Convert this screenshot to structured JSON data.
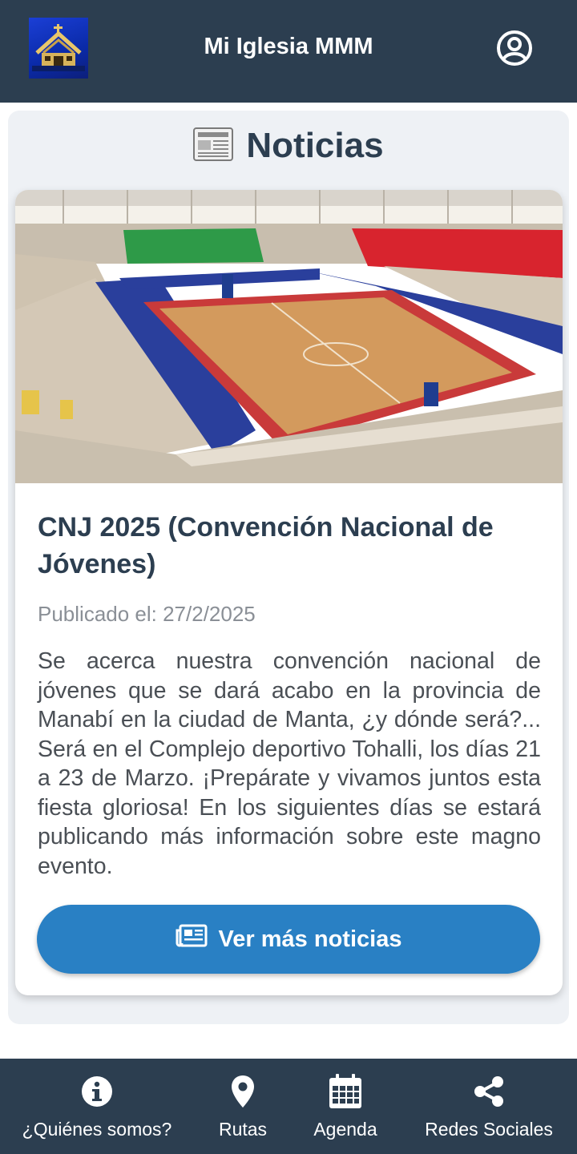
{
  "header": {
    "title": "Mi Iglesia MMM",
    "logo_icon": "church-logo-icon",
    "user_icon": "user-circle-icon"
  },
  "section": {
    "icon": "newspaper-icon",
    "title": "Noticias"
  },
  "news": {
    "image": "sports-arena-photo",
    "title": "CNJ 2025 (Convención Nacional de Jóvenes)",
    "date": "Publicado el: 27/2/2025",
    "body": "Se acerca nuestra convención nacional de jóvenes que se dará acabo en la provincia de Manabí en la ciudad de Manta, ¿y dónde será?... Será en el Complejo deportivo Tohalli, los días 21 a 23 de Marzo. ¡Prepárate y vivamos juntos esta fiesta gloriosa! En los siguientes días se estará publicando más información sobre este magno evento.",
    "button_label": "Ver más noticias",
    "button_icon": "newspaper-icon"
  },
  "bottom_nav": {
    "items": [
      {
        "label": "¿Quiénes somos?",
        "icon": "info-circle-icon"
      },
      {
        "label": "Rutas",
        "icon": "map-pin-icon"
      },
      {
        "label": "Agenda",
        "icon": "calendar-icon"
      },
      {
        "label": "Redes Sociales",
        "icon": "share-icon"
      }
    ]
  },
  "colors": {
    "header_bg": "#2c3e50",
    "title_text": "#2c3e50",
    "button_bg": "#2980c4",
    "panel_bg": "#eef1f5"
  }
}
